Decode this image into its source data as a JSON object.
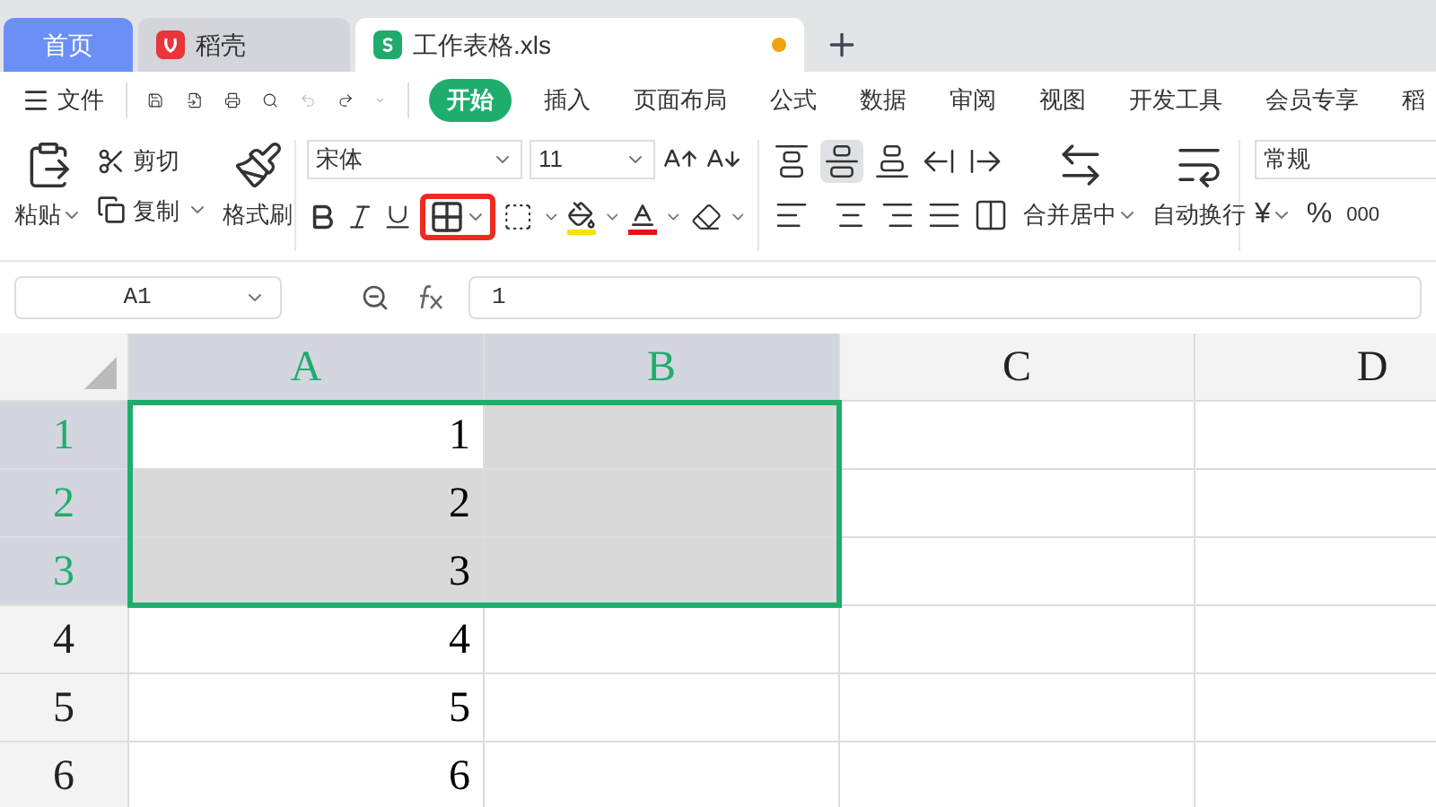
{
  "tabs": [
    {
      "kind": "home",
      "label": "首页",
      "selected": false
    },
    {
      "kind": "app",
      "label": "稻壳",
      "selected": false
    },
    {
      "kind": "doc",
      "label": "工作表格.xls",
      "selected": true,
      "unsaved": true
    }
  ],
  "menu": {
    "file": "文件",
    "items": [
      {
        "label": "开始",
        "selected": true
      },
      {
        "label": "插入",
        "selected": false
      },
      {
        "label": "页面布局",
        "selected": false
      },
      {
        "label": "公式",
        "selected": false
      },
      {
        "label": "数据",
        "selected": false
      },
      {
        "label": "审阅",
        "selected": false
      },
      {
        "label": "视图",
        "selected": false
      },
      {
        "label": "开发工具",
        "selected": false
      },
      {
        "label": "会员专享",
        "selected": false
      },
      {
        "label": "稻",
        "selected": false
      }
    ]
  },
  "toolbar": {
    "paste": "粘贴",
    "cut": "剪切",
    "copy": "复制",
    "format_painter": "格式刷",
    "font": "宋体",
    "font_size": "11",
    "border_highlighted": true,
    "merge": "合并居中",
    "wrap": "自动换行",
    "number_format": "常规",
    "currency": "¥",
    "percent": "%",
    "thousands": "000"
  },
  "formula_bar": {
    "cell": "A1",
    "value": "1"
  },
  "sheet": {
    "columns": [
      {
        "label": "A",
        "selected": true
      },
      {
        "label": "B",
        "selected": true
      },
      {
        "label": "C",
        "selected": false
      },
      {
        "label": "D",
        "selected": false
      }
    ],
    "rows": [
      {
        "label": "1",
        "selected": true,
        "cells": [
          {
            "value": "1",
            "active": true
          },
          {
            "active": false
          }
        ]
      },
      {
        "label": "2",
        "selected": true,
        "cells": [
          {
            "value": "2",
            "active": false
          },
          {
            "active": false
          }
        ]
      },
      {
        "label": "3",
        "selected": true,
        "cells": [
          {
            "value": "3",
            "active": false
          },
          {
            "active": false
          }
        ]
      },
      {
        "label": "4",
        "selected": false,
        "cells": [
          {
            "value": "4"
          }
        ]
      },
      {
        "label": "5",
        "selected": false,
        "cells": [
          {
            "value": "5"
          }
        ]
      },
      {
        "label": "6",
        "selected": false,
        "cells": [
          {
            "value": "6"
          }
        ]
      }
    ]
  }
}
